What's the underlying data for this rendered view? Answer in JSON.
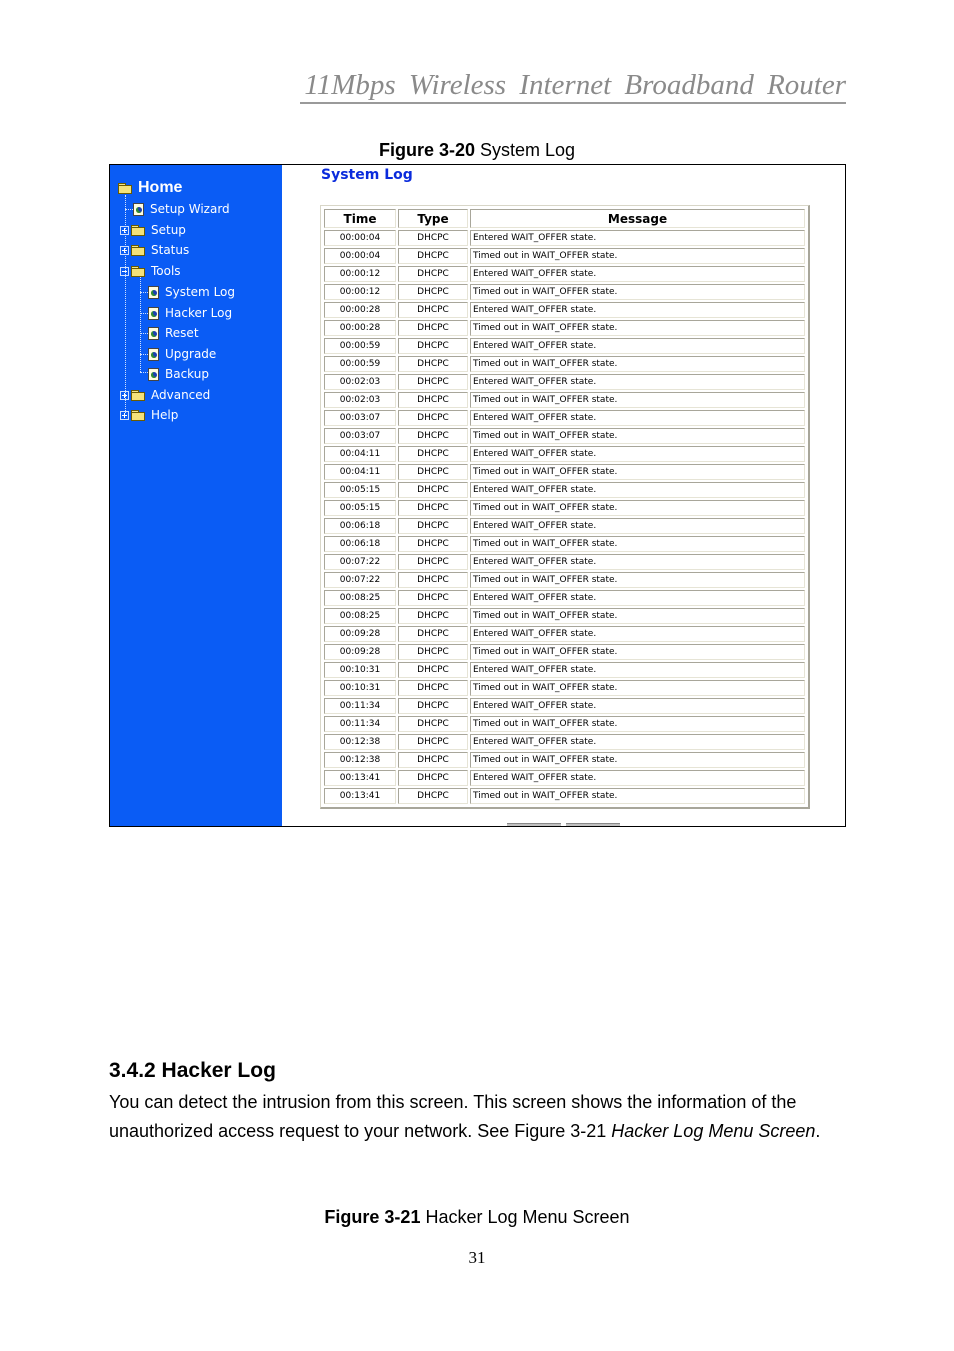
{
  "document": {
    "running_header": "11Mbps  Wireless  Internet  Broadband  Router",
    "figure_1": {
      "label": "Figure 3-20",
      "title": " System Log"
    },
    "section": {
      "heading": "3.4.2 Hacker Log",
      "text_1": "You can detect the intrusion from this screen. This screen shows the information of the unauthorized access request to your network. See Figure 3-21 ",
      "text_italic": "Hacker Log Menu Screen",
      "text_2": "."
    },
    "figure_2": {
      "label": "Figure 3-21",
      "title": " Hacker Log Menu Screen"
    },
    "page_number": "31"
  },
  "screenshot": {
    "sidebar": {
      "home": "Home",
      "items": [
        {
          "label": "Setup Wizard",
          "type": "page"
        },
        {
          "label": "Setup",
          "type": "folder"
        },
        {
          "label": "Status",
          "type": "folder"
        },
        {
          "label": "Tools",
          "type": "folder-open"
        },
        {
          "label": "System Log",
          "type": "page"
        },
        {
          "label": "Hacker Log",
          "type": "page"
        },
        {
          "label": "Reset",
          "type": "page"
        },
        {
          "label": "Upgrade",
          "type": "page"
        },
        {
          "label": "Backup",
          "type": "page"
        },
        {
          "label": "Advanced",
          "type": "folder"
        },
        {
          "label": "Help",
          "type": "folder"
        }
      ]
    },
    "content": {
      "title": "System Log",
      "columns": [
        "Time",
        "Type",
        "Message"
      ],
      "rows": [
        [
          "00:00:04",
          "DHCPC",
          "Entered WAIT_OFFER state."
        ],
        [
          "00:00:04",
          "DHCPC",
          "Timed out in WAIT_OFFER state."
        ],
        [
          "00:00:12",
          "DHCPC",
          "Entered WAIT_OFFER state."
        ],
        [
          "00:00:12",
          "DHCPC",
          "Timed out in WAIT_OFFER state."
        ],
        [
          "00:00:28",
          "DHCPC",
          "Entered WAIT_OFFER state."
        ],
        [
          "00:00:28",
          "DHCPC",
          "Timed out in WAIT_OFFER state."
        ],
        [
          "00:00:59",
          "DHCPC",
          "Entered WAIT_OFFER state."
        ],
        [
          "00:00:59",
          "DHCPC",
          "Timed out in WAIT_OFFER state."
        ],
        [
          "00:02:03",
          "DHCPC",
          "Entered WAIT_OFFER state."
        ],
        [
          "00:02:03",
          "DHCPC",
          "Timed out in WAIT_OFFER state."
        ],
        [
          "00:03:07",
          "DHCPC",
          "Entered WAIT_OFFER state."
        ],
        [
          "00:03:07",
          "DHCPC",
          "Timed out in WAIT_OFFER state."
        ],
        [
          "00:04:11",
          "DHCPC",
          "Entered WAIT_OFFER state."
        ],
        [
          "00:04:11",
          "DHCPC",
          "Timed out in WAIT_OFFER state."
        ],
        [
          "00:05:15",
          "DHCPC",
          "Entered WAIT_OFFER state."
        ],
        [
          "00:05:15",
          "DHCPC",
          "Timed out in WAIT_OFFER state."
        ],
        [
          "00:06:18",
          "DHCPC",
          "Entered WAIT_OFFER state."
        ],
        [
          "00:06:18",
          "DHCPC",
          "Timed out in WAIT_OFFER state."
        ],
        [
          "00:07:22",
          "DHCPC",
          "Entered WAIT_OFFER state."
        ],
        [
          "00:07:22",
          "DHCPC",
          "Timed out in WAIT_OFFER state."
        ],
        [
          "00:08:25",
          "DHCPC",
          "Entered WAIT_OFFER state."
        ],
        [
          "00:08:25",
          "DHCPC",
          "Timed out in WAIT_OFFER state."
        ],
        [
          "00:09:28",
          "DHCPC",
          "Entered WAIT_OFFER state."
        ],
        [
          "00:09:28",
          "DHCPC",
          "Timed out in WAIT_OFFER state."
        ],
        [
          "00:10:31",
          "DHCPC",
          "Entered WAIT_OFFER state."
        ],
        [
          "00:10:31",
          "DHCPC",
          "Timed out in WAIT_OFFER state."
        ],
        [
          "00:11:34",
          "DHCPC",
          "Entered WAIT_OFFER state."
        ],
        [
          "00:11:34",
          "DHCPC",
          "Timed out in WAIT_OFFER state."
        ],
        [
          "00:12:38",
          "DHCPC",
          "Entered WAIT_OFFER state."
        ],
        [
          "00:12:38",
          "DHCPC",
          "Timed out in WAIT_OFFER state."
        ],
        [
          "00:13:41",
          "DHCPC",
          "Entered WAIT_OFFER state."
        ],
        [
          "00:13:41",
          "DHCPC",
          "Timed out in WAIT_OFFER state."
        ]
      ]
    },
    "colors": {
      "sidebar_bg": "#0a5cf5",
      "title_blue": "#0a2bdc"
    }
  }
}
